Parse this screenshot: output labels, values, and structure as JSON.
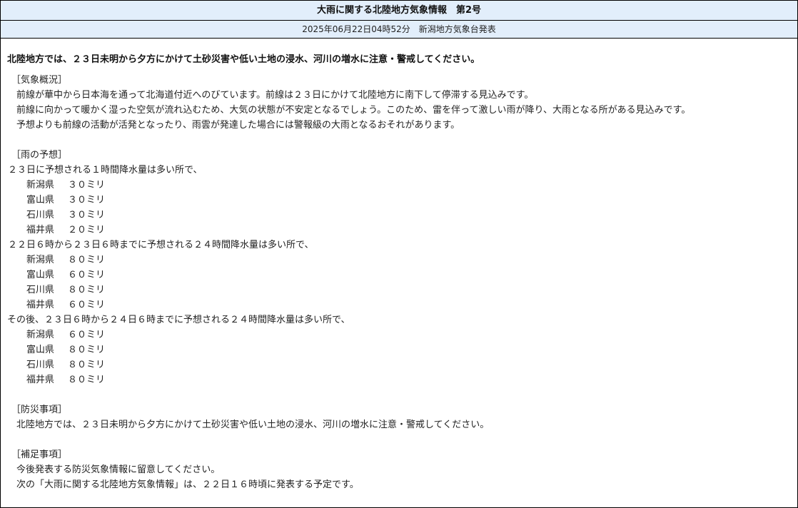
{
  "header": {
    "title": "大雨に関する北陸地方気象情報　第2号",
    "issued": "2025年06月22日04時52分　新潟地方気象台発表"
  },
  "headline": "北陸地方では、２３日未明から夕方にかけて土砂災害や低い土地の浸水、河川の増水に注意・警戒してください。",
  "overview": {
    "heading": "［気象概況］",
    "lines": [
      "前線が華中から日本海を通って北海道付近へのびています。前線は２３日にかけて北陸地方に南下して停滞する見込みです。",
      "前線に向かって暖かく湿った空気が流れ込むため、大気の状態が不安定となるでしょう。このため、雷を伴って激しい雨が降り、大雨となる所がある見込みです。",
      "予想よりも前線の活動が活発となったり、雨雲が発達した場合には警報級の大雨となるおそれがあります。"
    ]
  },
  "rain": {
    "heading": "［雨の予想］",
    "groups": [
      {
        "intro": "２３日に予想される１時間降水量は多い所で、",
        "items": [
          {
            "pref": "新潟県",
            "amount": "３０ミリ"
          },
          {
            "pref": "富山県",
            "amount": "３０ミリ"
          },
          {
            "pref": "石川県",
            "amount": "３０ミリ"
          },
          {
            "pref": "福井県",
            "amount": "２０ミリ"
          }
        ]
      },
      {
        "intro": "２２日６時から２３日６時までに予想される２４時間降水量は多い所で、",
        "items": [
          {
            "pref": "新潟県",
            "amount": "８０ミリ"
          },
          {
            "pref": "富山県",
            "amount": "６０ミリ"
          },
          {
            "pref": "石川県",
            "amount": "８０ミリ"
          },
          {
            "pref": "福井県",
            "amount": "６０ミリ"
          }
        ]
      },
      {
        "intro": "その後、２３日６時から２４日６時までに予想される２４時間降水量は多い所で、",
        "items": [
          {
            "pref": "新潟県",
            "amount": "６０ミリ"
          },
          {
            "pref": "富山県",
            "amount": "８０ミリ"
          },
          {
            "pref": "石川県",
            "amount": "８０ミリ"
          },
          {
            "pref": "福井県",
            "amount": "８０ミリ"
          }
        ]
      }
    ]
  },
  "disaster": {
    "heading": "［防災事項］",
    "lines": [
      "北陸地方では、２３日未明から夕方にかけて土砂災害や低い土地の浸水、河川の増水に注意・警戒してください。"
    ]
  },
  "supplement": {
    "heading": "［補足事項］",
    "lines": [
      "今後発表する防災気象情報に留意してください。",
      "次の「大雨に関する北陸地方気象情報」は、２２日１６時頃に発表する予定です。"
    ]
  }
}
